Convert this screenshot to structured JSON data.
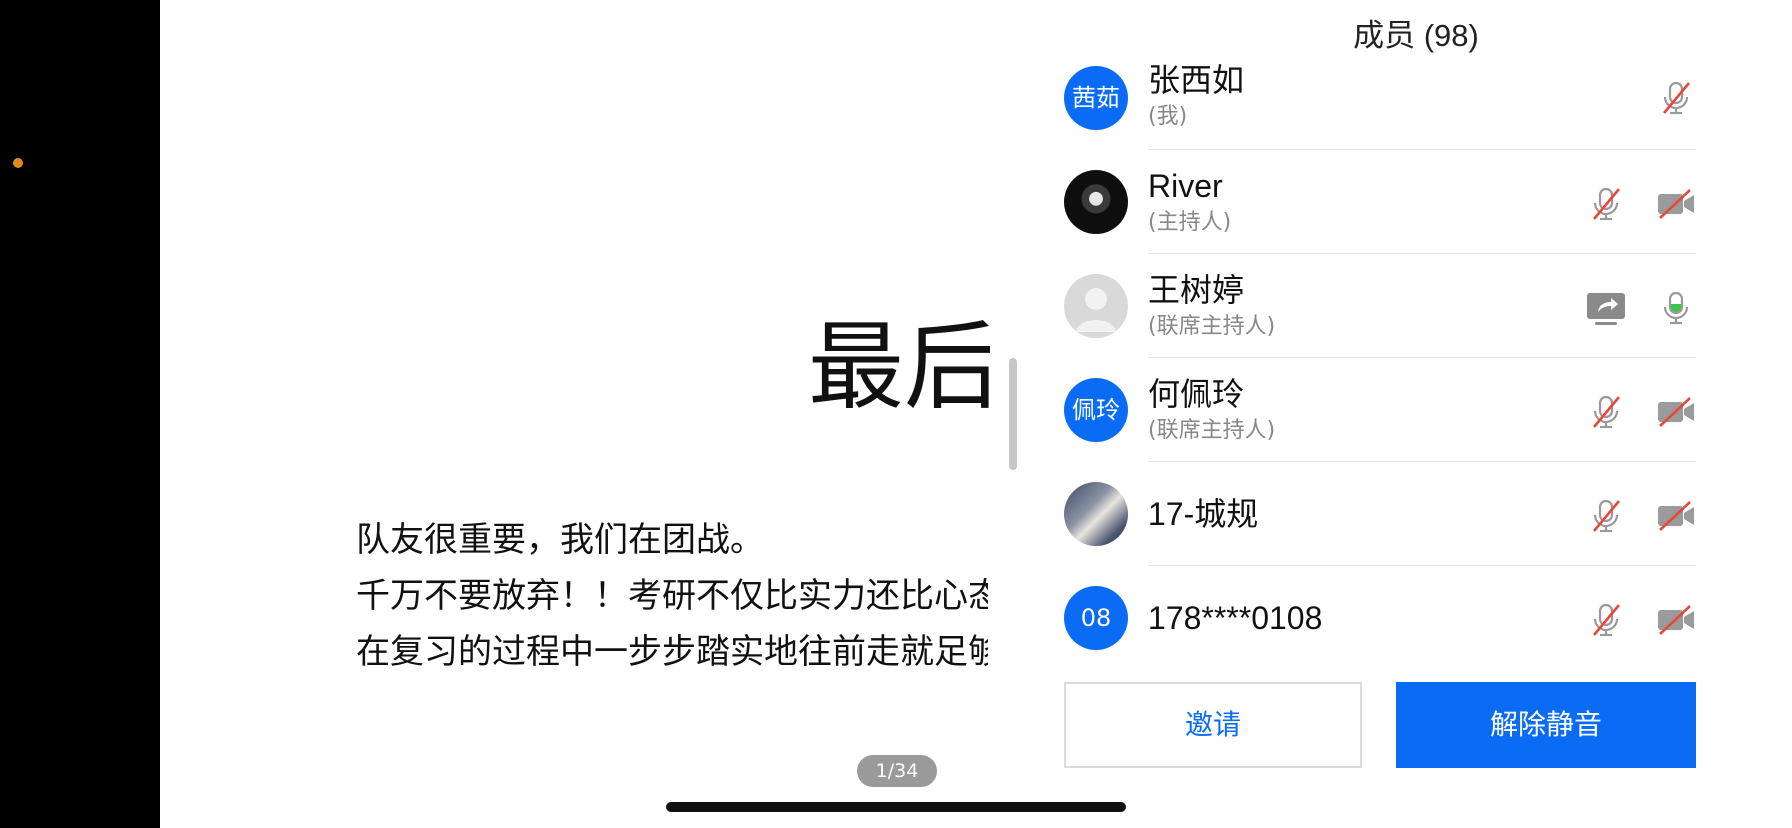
{
  "slide": {
    "title": "最后",
    "lines": [
      "队友很重要，我们在团战。",
      "千万不要放弃！！考研不仅比实力还比心态",
      "在复习的过程中一步步踏实地往前走就足够了"
    ],
    "page_indicator": "1/34"
  },
  "panel": {
    "title": "成员 (98)",
    "members": [
      {
        "avatar_text": "茜茹",
        "name": "张西如",
        "role": "(我)",
        "icons": [
          "mic-muted-icon"
        ]
      },
      {
        "avatar_text": "",
        "name": "River",
        "role": "(主持人)",
        "icons": [
          "mic-muted-icon",
          "camera-off-icon"
        ]
      },
      {
        "avatar_text": "",
        "name": "王树婷",
        "role": "(联席主持人)",
        "icons": [
          "screen-share-icon",
          "mic-active-icon"
        ]
      },
      {
        "avatar_text": "佩玲",
        "name": "何佩玲",
        "role": "(联席主持人)",
        "icons": [
          "mic-muted-icon",
          "camera-off-icon"
        ]
      },
      {
        "avatar_text": "",
        "name": "17-城规",
        "role": "",
        "icons": [
          "mic-muted-icon",
          "camera-off-icon"
        ]
      },
      {
        "avatar_text": "08",
        "name": "178****0108",
        "role": "",
        "icons": [
          "mic-muted-icon",
          "camera-off-icon"
        ]
      }
    ],
    "invite_label": "邀请",
    "unmute_label": "解除静音"
  },
  "colors": {
    "accent": "#0a6cf5",
    "muted_red": "#e8483a",
    "icon_gray": "#9a9a9a",
    "mic_active": "#37c74a",
    "indicator_dot": "#e08a1e"
  }
}
